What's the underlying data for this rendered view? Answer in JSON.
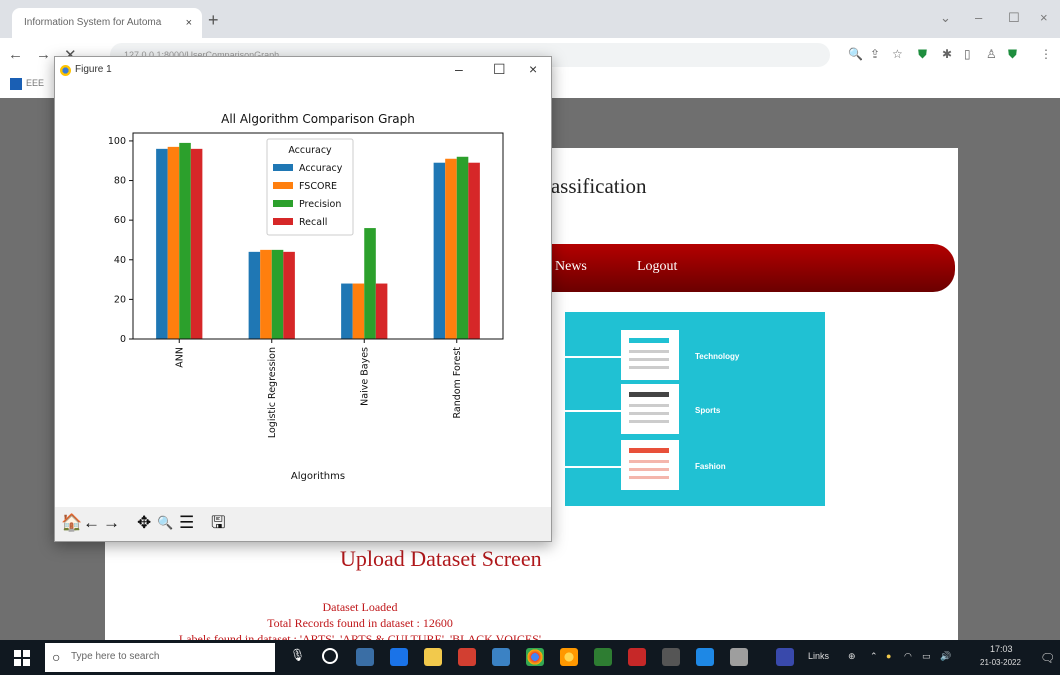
{
  "browser": {
    "tab_title": "Information System for Automa",
    "tab_close": "×",
    "new_tab": "+",
    "address": "127.0.0.1:8000/UserComparisonGraph",
    "bookmark": "EEE"
  },
  "site": {
    "title_fragment": "lassification",
    "nav": [
      "News",
      "Logout"
    ],
    "banner_items": [
      "Technology",
      "Sports",
      "Fashion"
    ],
    "upload_title": "Upload Dataset Screen",
    "status_lines": [
      "Dataset Loaded",
      "Total Records found in dataset : 12600",
      "Labels found in dataset : 'ARTS', 'ARTS & CULTURE', 'BLACK VOICES'"
    ]
  },
  "figure_window": {
    "title": "Figure 1",
    "minimize": "–",
    "maximize": "☐",
    "close": "×"
  },
  "chart_data": {
    "type": "bar",
    "title": "All Algorithm Comparison Graph",
    "xlabel": "Algorithms",
    "ylabel": "",
    "categories": [
      "ANN",
      "Logistic Regression",
      "Naive Bayes",
      "Random Forest"
    ],
    "series": [
      {
        "name": "Accuracy",
        "color": "#1f77b4",
        "values": [
          96,
          44,
          28,
          89
        ]
      },
      {
        "name": "FSCORE",
        "color": "#ff7f0e",
        "values": [
          97,
          45,
          28,
          91
        ]
      },
      {
        "name": "Precision",
        "color": "#2ca02c",
        "values": [
          99,
          45,
          56,
          92
        ]
      },
      {
        "name": "Recall",
        "color": "#d62728",
        "values": [
          96,
          44,
          28,
          89
        ]
      }
    ],
    "legend_title": "Accuracy",
    "legend_position": "top-center",
    "ylim": [
      0,
      104
    ],
    "yticks": [
      0,
      20,
      40,
      60,
      80,
      100
    ],
    "grid": false
  },
  "fig_toolbar": {
    "home": "🏠",
    "back": "←",
    "forward": "→",
    "pan": "✥",
    "zoom": "🔍",
    "configure": "☰",
    "save": "🖫"
  },
  "taskbar": {
    "search_placeholder": "Type here to search",
    "tray_text": "Links",
    "clock_time": "17:03",
    "clock_date": "21-03-2022"
  }
}
